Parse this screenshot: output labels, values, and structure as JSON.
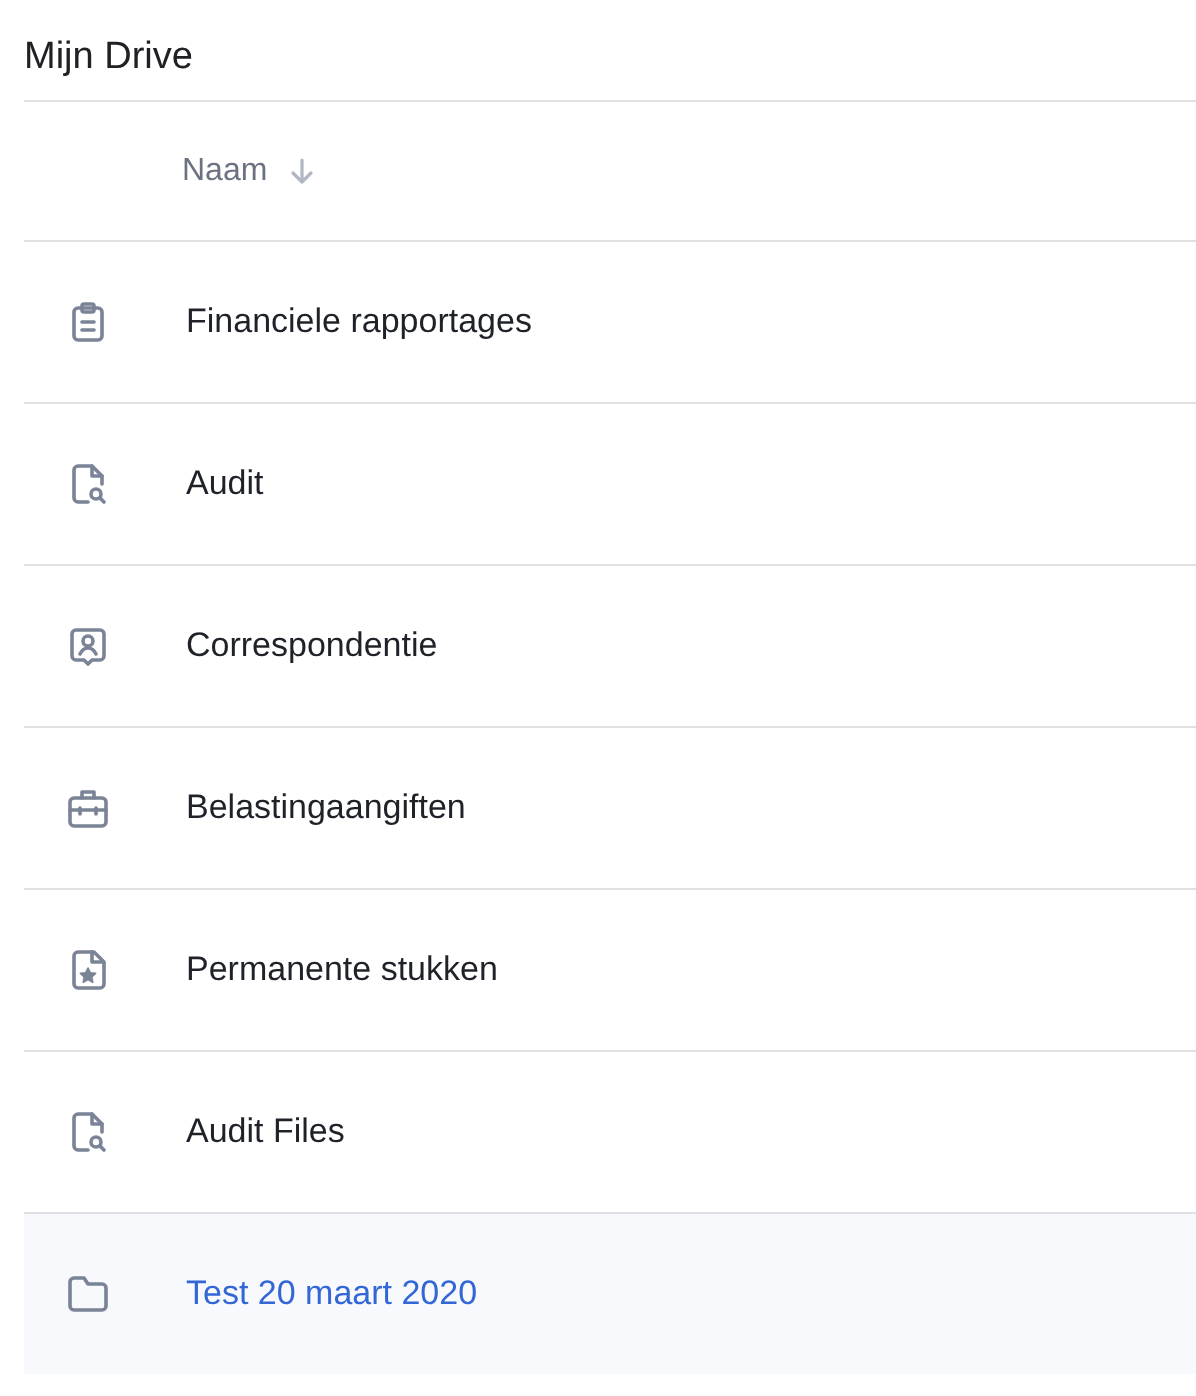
{
  "title": "Mijn Drive",
  "table": {
    "columns": [
      {
        "label": "Naam",
        "sort_descending": true
      }
    ],
    "rows": [
      {
        "kind": "clipboard",
        "name": "Financiele rapportages",
        "selected": false
      },
      {
        "kind": "file-search",
        "name": "Audit",
        "selected": false
      },
      {
        "kind": "contact",
        "name": "Correspondentie",
        "selected": false
      },
      {
        "kind": "briefcase",
        "name": "Belastingaangiften",
        "selected": false
      },
      {
        "kind": "file-star",
        "name": "Permanente stukken",
        "selected": false
      },
      {
        "kind": "file-search",
        "name": "Audit Files",
        "selected": false
      },
      {
        "kind": "folder",
        "name": "Test 20 maart 2020",
        "selected": true
      }
    ]
  }
}
